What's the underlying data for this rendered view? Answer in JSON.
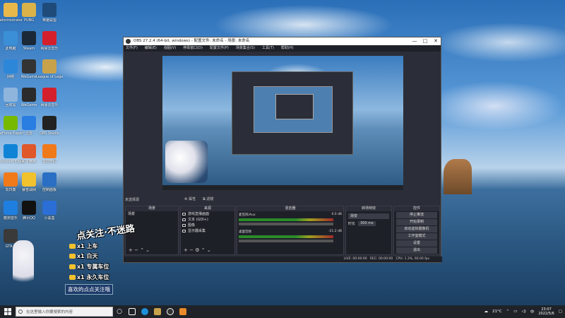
{
  "desktop": {
    "icons": [
      {
        "label": "Administrator",
        "color": "#e9b84a"
      },
      {
        "label": "PUBG",
        "color": "#d9b24a"
      },
      {
        "label": "英雄联盟",
        "color": "#1e4b7a"
      },
      {
        "label": "此电脑",
        "color": "#3b8fd6"
      },
      {
        "label": "Steam",
        "color": "#1b2838"
      },
      {
        "label": "网易云音乐",
        "color": "#d4202c"
      },
      {
        "label": "网络",
        "color": "#2d87d9"
      },
      {
        "label": "WeGame",
        "color": "#333333"
      },
      {
        "label": "League of Legends",
        "color": "#c8a24a"
      },
      {
        "label": "回收站",
        "color": "#8fb5dc"
      },
      {
        "label": "WeGame",
        "color": "#2b2b2b"
      },
      {
        "label": "网易云音乐",
        "color": "#d4202c"
      },
      {
        "label": "GeForce Experience",
        "color": "#76b900"
      },
      {
        "label": "迅雷",
        "color": "#2a7de1"
      },
      {
        "label": "OBS Studio",
        "color": "#222222"
      },
      {
        "label": "Microsoft Edge",
        "color": "#0f84d6"
      },
      {
        "label": "和平精英",
        "color": "#e0572a"
      },
      {
        "label": "永劫无间",
        "color": "#f07a1a"
      },
      {
        "label": "向日葵",
        "color": "#f07a1a"
      },
      {
        "label": "暴雪战网",
        "color": "#f2c12e"
      },
      {
        "label": "控制面板",
        "color": "#2a6fc4"
      },
      {
        "label": "酷狗音乐",
        "color": "#1f7fe0"
      },
      {
        "label": "腾讯QQ",
        "color": "#111111"
      },
      {
        "label": "小黑盒",
        "color": "#2b6fd6"
      },
      {
        "label": "GTA V",
        "color": "#3a3a3a"
      }
    ]
  },
  "obs": {
    "title": "OBS 27.2.4 (64-bit, windows) - 配置文件: 未命名 - 场景: 未命名",
    "window_controls": {
      "minimize": "—",
      "maximize": "□",
      "close": "✕"
    },
    "menu": [
      "文件(F)",
      "编辑(E)",
      "视图(V)",
      "停靠窗口(D)",
      "配置文件(P)",
      "场景集合(S)",
      "工具(T)",
      "帮助(H)"
    ],
    "preview_label": "未选择源",
    "toolbar": [
      "⚙ 属性",
      "⧉ 滤镜"
    ],
    "docks": {
      "scenes": {
        "title": "场景",
        "items": [
          "场景"
        ]
      },
      "sources": {
        "title": "来源",
        "items": [
          "游戏直播画面",
          "文本 (GDI+)",
          "图像",
          "显示器采集"
        ]
      },
      "mixer": {
        "title": "混音器",
        "channels": [
          {
            "name": "麦克风/Aux",
            "db": "0.0 dB"
          },
          {
            "name": "桌面音频",
            "db": "-21.2 dB"
          }
        ]
      },
      "transitions": {
        "title": "转场特效",
        "type": "渐变",
        "duration_label": "时长",
        "duration": "300 ms"
      },
      "controls": {
        "title": "控件",
        "buttons": [
          "停止推流",
          "开始录制",
          "启动虚拟摄像机",
          "工作室模式",
          "设置",
          "退出"
        ]
      }
    },
    "statusbar": {
      "live": "LIVE: 00:00:00",
      "rec": "REC: 00:00:00",
      "cpu": "CPU: 1.3%, 60.00 fps"
    }
  },
  "overlay": {
    "heading": "点关注·不迷路",
    "lines": [
      {
        "prefix": "x1",
        "text": "上车"
      },
      {
        "prefix": "x1",
        "text": "白天"
      },
      {
        "prefix": "x1",
        "text": "专属车位"
      },
      {
        "prefix": "x1",
        "text": "永久车位"
      }
    ],
    "footer": "喜欢的点点关注哦"
  },
  "taskbar": {
    "search_placeholder": "在这里输入你要搜索的内容",
    "weather": "21°C",
    "clock_time": "23:07",
    "clock_date": "2022/5/6"
  }
}
